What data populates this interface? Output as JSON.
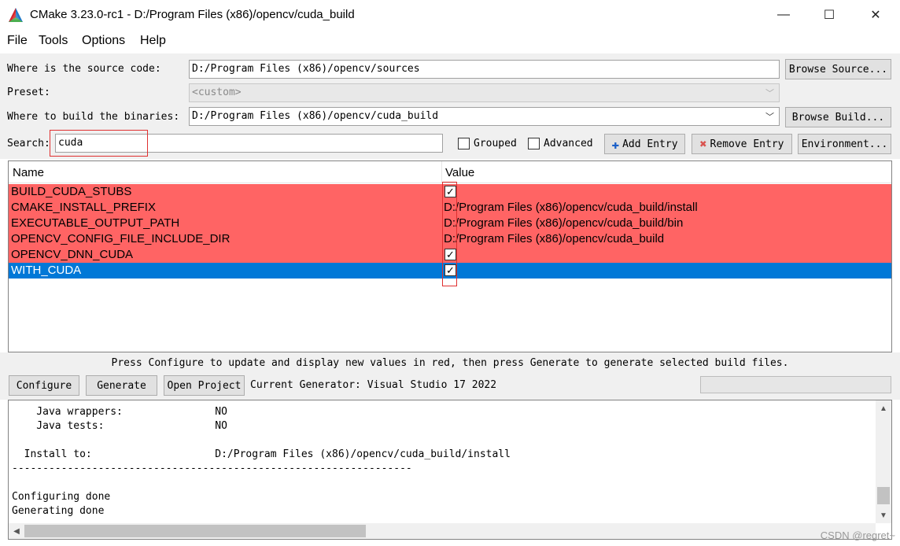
{
  "window": {
    "title": "CMake 3.23.0-rc1 - D:/Program Files (x86)/opencv/cuda_build",
    "controls": {
      "minimize": "—",
      "maximize": "☐",
      "close": "✕"
    }
  },
  "menu": [
    "File",
    "Tools",
    "Options",
    "Help"
  ],
  "form": {
    "source_label": "Where is the source code:",
    "source_value": "D:/Program Files (x86)/opencv/sources",
    "browse_source": "Browse Source...",
    "preset_label": "Preset:",
    "preset_value": "<custom>",
    "build_label": "Where to build the binaries:",
    "build_value": "D:/Program Files (x86)/opencv/cuda_build",
    "browse_build": "Browse Build...",
    "search_label": "Search:",
    "search_value": "cuda",
    "grouped_label": "Grouped",
    "advanced_label": "Advanced",
    "add_entry": "Add Entry",
    "remove_entry": "Remove Entry",
    "environment": "Environment..."
  },
  "table": {
    "headers": {
      "name": "Name",
      "value": "Value"
    },
    "rows": [
      {
        "name": "BUILD_CUDA_STUBS",
        "value": "",
        "checked": true
      },
      {
        "name": "CMAKE_INSTALL_PREFIX",
        "value": "D:/Program Files (x86)/opencv/cuda_build/install"
      },
      {
        "name": "EXECUTABLE_OUTPUT_PATH",
        "value": "D:/Program Files (x86)/opencv/cuda_build/bin"
      },
      {
        "name": "OPENCV_CONFIG_FILE_INCLUDE_DIR",
        "value": "D:/Program Files (x86)/opencv/cuda_build"
      },
      {
        "name": "OPENCV_DNN_CUDA",
        "value": "",
        "checked": true
      },
      {
        "name": "WITH_CUDA",
        "value": "",
        "checked": true,
        "selected": true
      }
    ],
    "check_mark": "✓"
  },
  "hint": "Press Configure to update and display new values in red, then press Generate to generate selected build files.",
  "actions": {
    "configure": "Configure",
    "generate": "Generate",
    "open_project": "Open Project",
    "current_generator": "Current Generator: Visual Studio 17 2022"
  },
  "output_lines": [
    "    Java wrappers:               NO",
    "    Java tests:                  NO",
    "",
    "  Install to:                    D:/Program Files (x86)/opencv/cuda_build/install",
    "-----------------------------------------------------------------",
    "",
    "Configuring done",
    "Generating done"
  ],
  "scroll_arrows": {
    "up": "▲",
    "down": "▼",
    "left": "◀"
  },
  "watermark": "CSDN @regret~",
  "colors": {
    "modified_row": "#ff6464",
    "selected_row": "#0078d7",
    "highlight_box": "#e03030"
  }
}
